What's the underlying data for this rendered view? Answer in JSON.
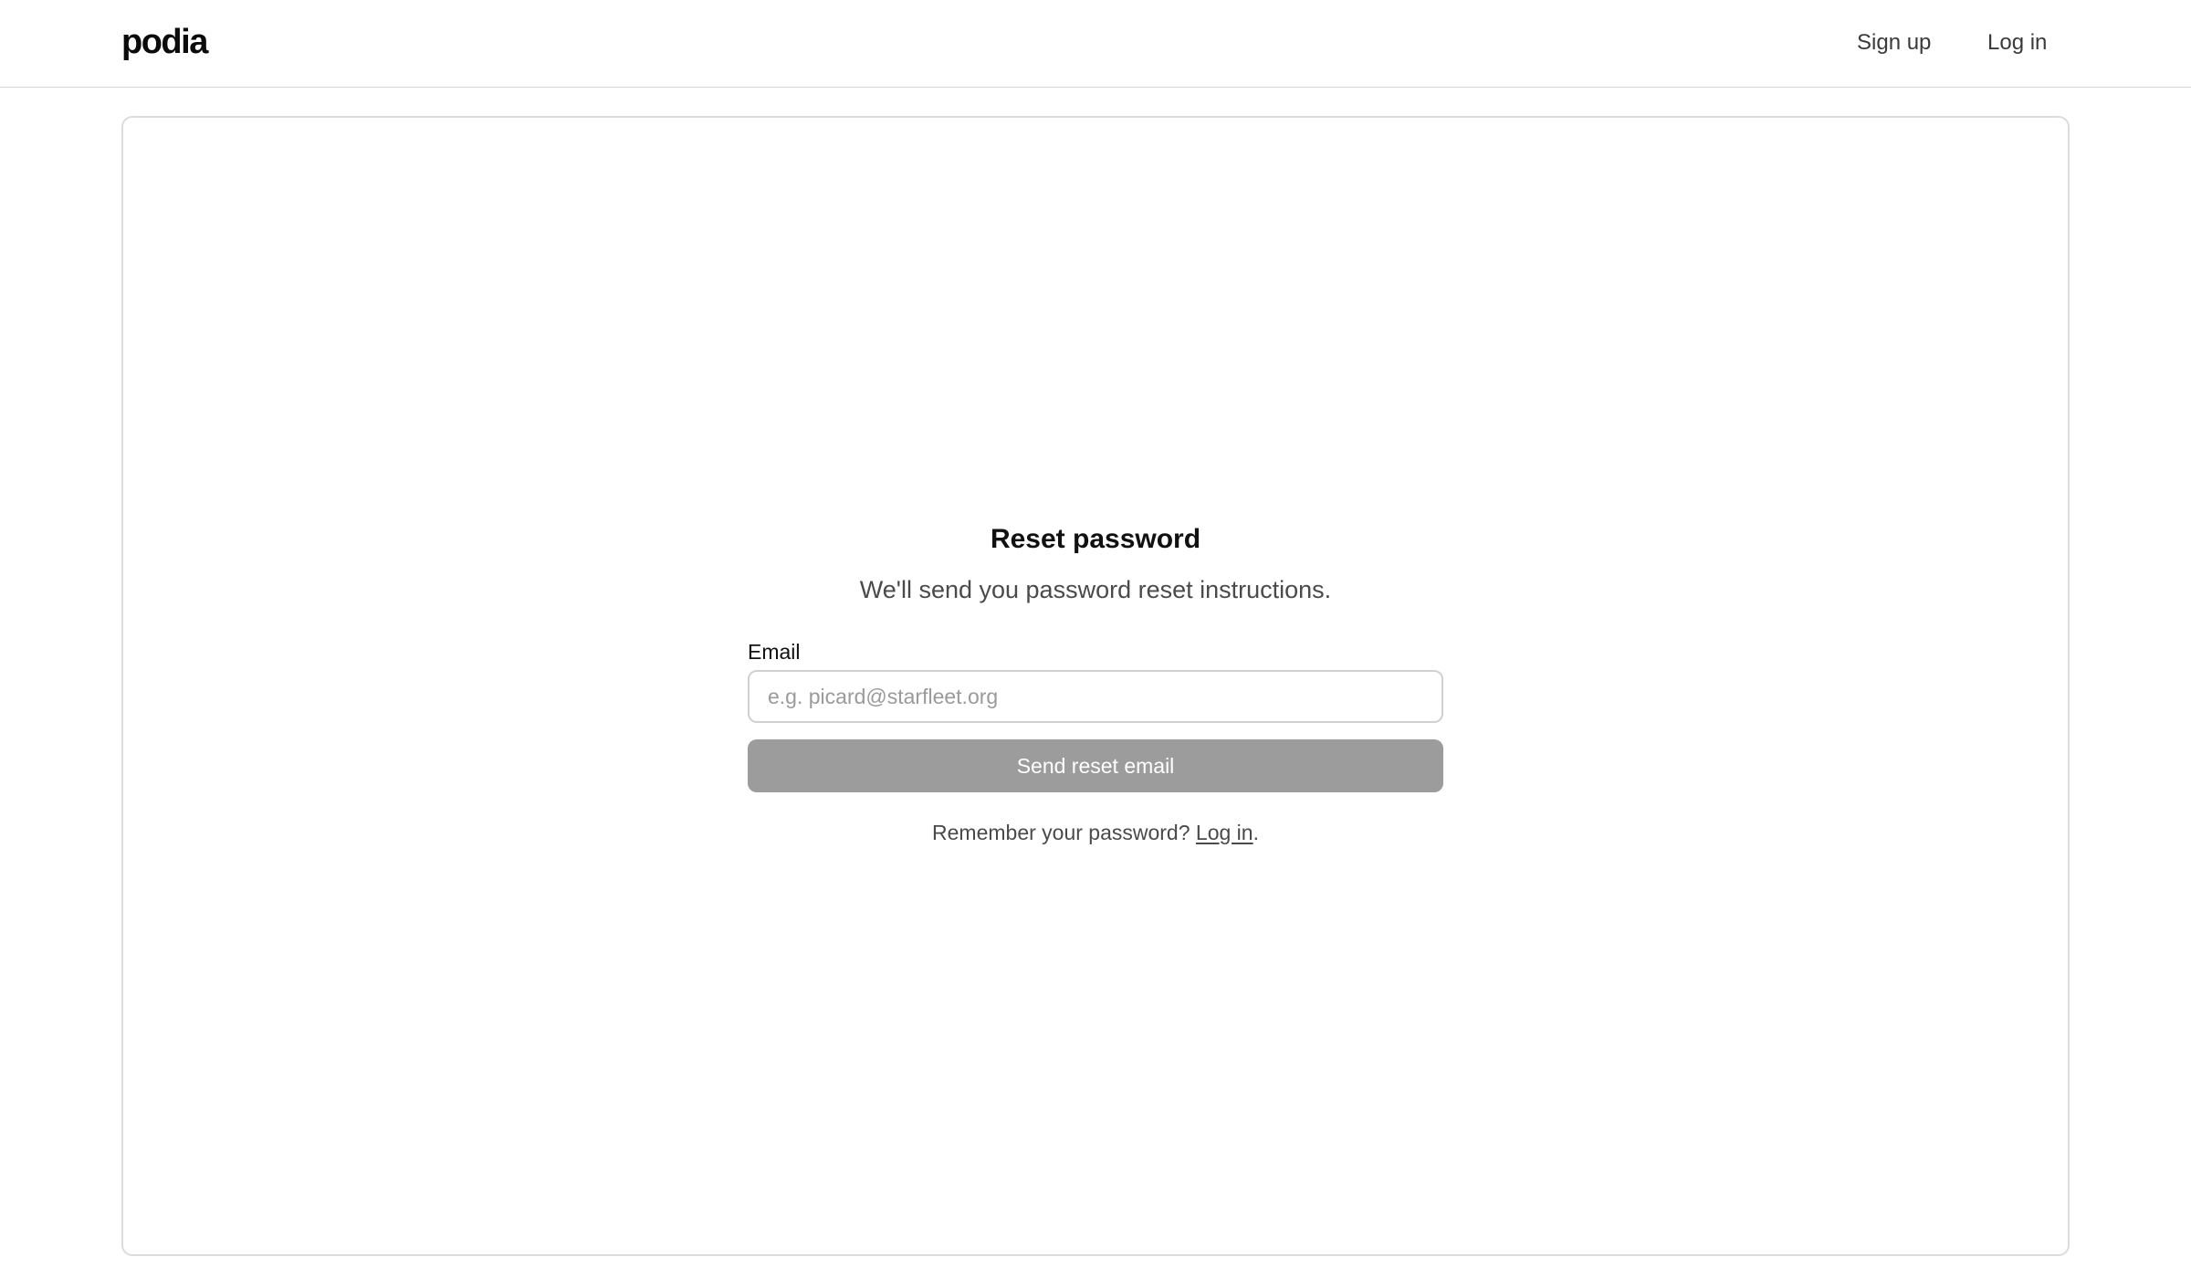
{
  "header": {
    "logo_text": "podia",
    "nav": {
      "signup_label": "Sign up",
      "login_label": "Log in"
    }
  },
  "form": {
    "title": "Reset password",
    "subtitle": "We'll send you password reset instructions.",
    "email_label": "Email",
    "email_value": "",
    "email_placeholder": "e.g. picard@starfleet.org",
    "submit_label": "Send reset email",
    "submit_state": "disabled"
  },
  "footer_prompt": {
    "text": "Remember your password? ",
    "link_label": "Log in",
    "suffix": "."
  },
  "colors": {
    "button_disabled_bg": "#9c9c9d",
    "border": "#dcdcdc",
    "text_muted": "#4a4a4a"
  }
}
